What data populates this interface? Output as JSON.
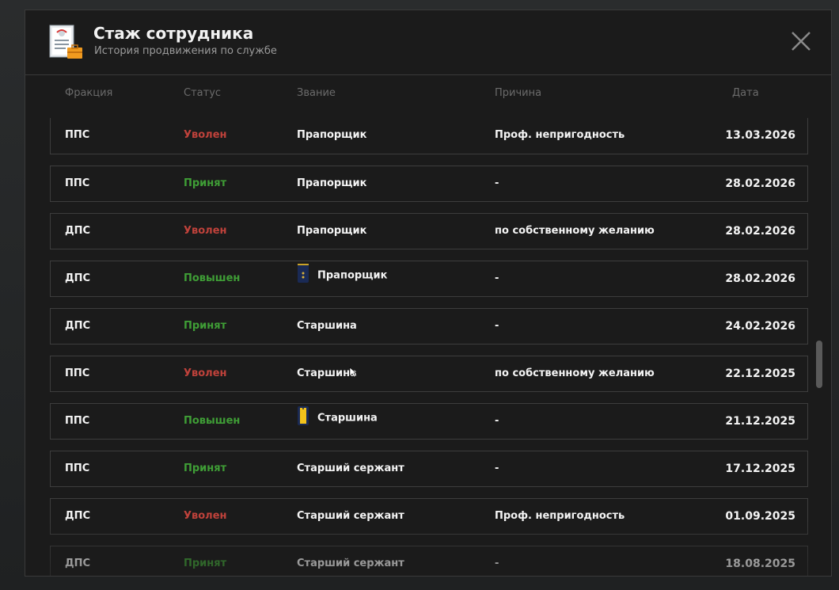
{
  "header": {
    "title": "Стаж сотрудника",
    "subtitle": "История продвижения по службе",
    "icon": "document-with-briefcase-icon",
    "close_icon": "close-icon"
  },
  "columns": [
    "Фракция",
    "Статус",
    "Звание",
    "Причина",
    "Дата"
  ],
  "rows": [
    {
      "faction": "ППС",
      "status": "Уволен",
      "status_color": "#c0423b",
      "rank": "Прапорщик",
      "rank_icon": null,
      "reason": "Проф. непригодность",
      "date": "13.03.2026"
    },
    {
      "faction": "ППС",
      "status": "Принят",
      "status_color": "#3f9e36",
      "rank": "Прапорщик",
      "rank_icon": null,
      "reason": "-",
      "date": "28.02.2026"
    },
    {
      "faction": "ДПС",
      "status": "Уволен",
      "status_color": "#c0423b",
      "rank": "Прапорщик",
      "rank_icon": null,
      "reason": "по собственному желанию",
      "date": "28.02.2026"
    },
    {
      "faction": "ДПС",
      "status": "Повышен",
      "status_color": "#3f9e36",
      "rank": "Прапорщик",
      "rank_icon": "shoulder-strap-praporshchik-icon",
      "reason": "-",
      "date": "28.02.2026"
    },
    {
      "faction": "ДПС",
      "status": "Принят",
      "status_color": "#3f9e36",
      "rank": "Старшина",
      "rank_icon": null,
      "reason": "-",
      "date": "24.02.2026"
    },
    {
      "faction": "ППС",
      "status": "Уволен",
      "status_color": "#c0423b",
      "rank": "Старшина",
      "rank_icon": null,
      "reason": "по собственному желанию",
      "date": "22.12.2025"
    },
    {
      "faction": "ППС",
      "status": "Повышен",
      "status_color": "#3f9e36",
      "rank": "Старшина",
      "rank_icon": "shoulder-strap-starshina-icon",
      "reason": "-",
      "date": "21.12.2025"
    },
    {
      "faction": "ППС",
      "status": "Принят",
      "status_color": "#3f9e36",
      "rank": "Старший сержант",
      "rank_icon": null,
      "reason": "-",
      "date": "17.12.2025"
    },
    {
      "faction": "ДПС",
      "status": "Уволен",
      "status_color": "#c0423b",
      "rank": "Старший сержант",
      "rank_icon": null,
      "reason": "Проф. непригодность",
      "date": "01.09.2025"
    },
    {
      "faction": "ДПС",
      "status": "Принят",
      "status_color": "#3f9e36",
      "rank": "Старший сержант",
      "rank_icon": null,
      "reason": "-",
      "date": "18.08.2025"
    }
  ]
}
